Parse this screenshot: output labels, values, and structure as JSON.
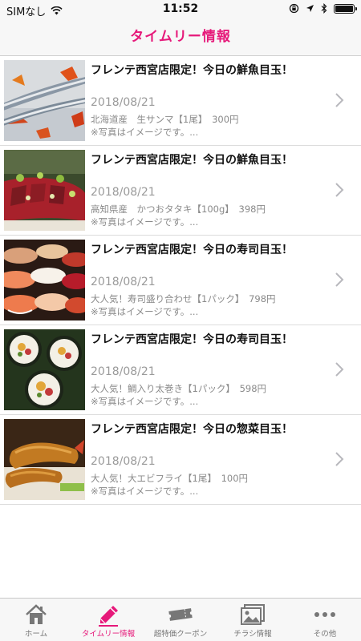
{
  "status_bar": {
    "carrier": "SIMなし",
    "time": "11:52"
  },
  "nav": {
    "title": "タイムリー情報"
  },
  "items": [
    {
      "title": "フレンテ西宮店限定！今日の鮮魚目玉！",
      "date": "2018/08/21",
      "desc": "北海道産　生サンマ【1尾】　300円",
      "note": "※写真はイメージです。..."
    },
    {
      "title": "フレンテ西宮店限定！今日の鮮魚目玉！",
      "date": "2018/08/21",
      "desc": "高知県産　かつおタタキ【100g】　398円",
      "note": "※写真はイメージです。..."
    },
    {
      "title": "フレンテ西宮店限定！今日の寿司目玉！",
      "date": "2018/08/21",
      "desc": "大人気！寿司盛り合わせ【1パック】　798円",
      "note": "※写真はイメージです。..."
    },
    {
      "title": "フレンテ西宮店限定！今日の寿司目玉！",
      "date": "2018/08/21",
      "desc": "大人気！鯛入り太巻き【1パック】　598円",
      "note": "※写真はイメージです。..."
    },
    {
      "title": "フレンテ西宮店限定！今日の惣菜目玉！",
      "date": "2018/08/21",
      "desc": "大人気！大エビフライ【1尾】　100円",
      "note": "※写真はイメージです。..."
    }
  ],
  "tabs": [
    {
      "label": "ホーム",
      "icon": "home-icon"
    },
    {
      "label": "タイムリー情報",
      "icon": "pencil-icon",
      "active": true
    },
    {
      "label": "超特価クーポン",
      "icon": "ticket-icon"
    },
    {
      "label": "チラシ情報",
      "icon": "flyer-icon"
    },
    {
      "label": "その他",
      "icon": "more-icon"
    }
  ],
  "colors": {
    "accent": "#e6197a",
    "tab_inactive": "#777777",
    "meta_text": "#9a9a9a"
  }
}
